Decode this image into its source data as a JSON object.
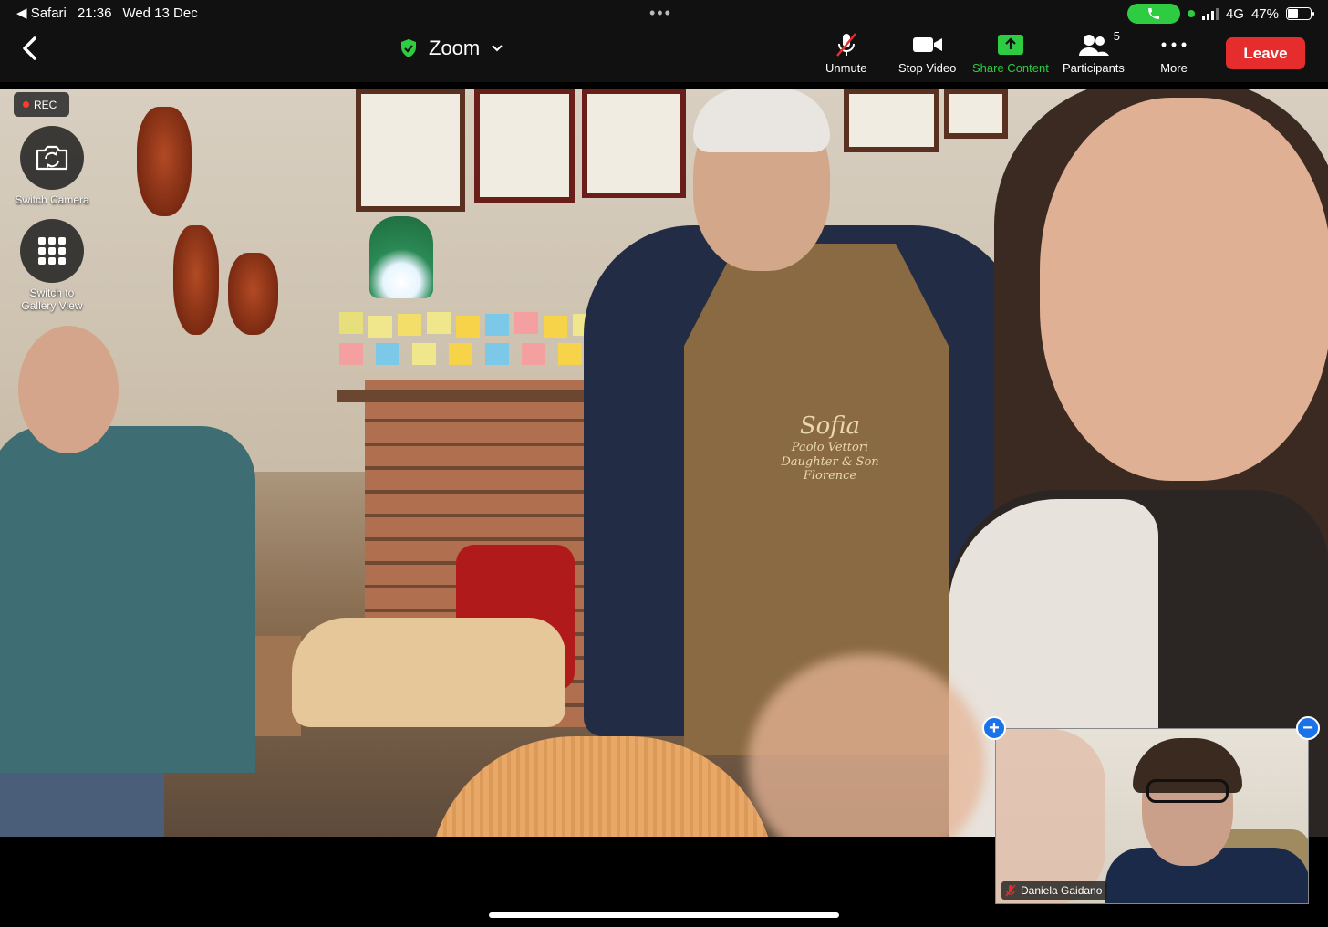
{
  "status_bar": {
    "back_app": "Safari",
    "time": "21:36",
    "date": "Wed 13 Dec",
    "network": "4G",
    "battery": "47%",
    "battery_level": 0.47
  },
  "toolbar": {
    "meeting_title": "Zoom",
    "unmute": "Unmute",
    "stop_video": "Stop Video",
    "share_content": "Share Content",
    "participants": "Participants",
    "participants_count": "5",
    "more": "More",
    "leave": "Leave"
  },
  "overlay": {
    "rec": "REC",
    "switch_camera": "Switch Camera",
    "switch_gallery_line1": "Switch to",
    "switch_gallery_line2": "Gallery View"
  },
  "video": {
    "apron_line1": "Sofia",
    "apron_line2": "Paolo Vettori",
    "apron_line3": "Daughter & Son",
    "apron_line4": "Florence"
  },
  "self_view": {
    "name": "Daniela Gaidano"
  },
  "colors": {
    "leave_red": "#e52d2d",
    "share_green": "#2ecc40",
    "accent_blue": "#1a73e8"
  }
}
